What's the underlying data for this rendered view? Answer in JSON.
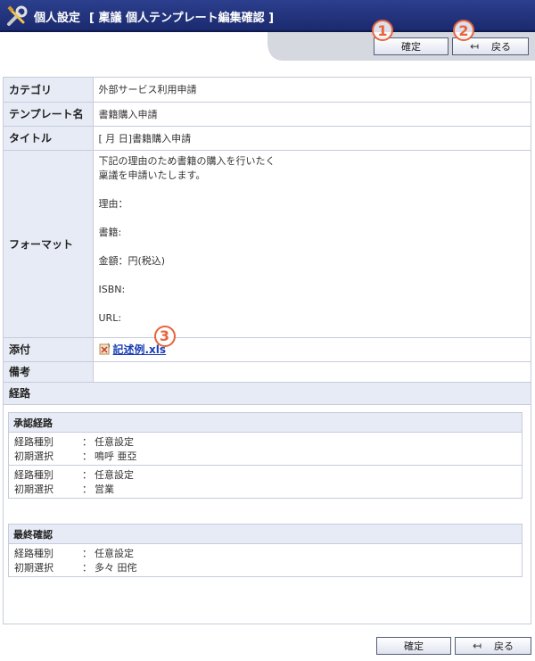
{
  "header": {
    "title": "個人設定",
    "subtitle": "[ 稟議 個人テンプレート編集確認 ]"
  },
  "toolbar": {
    "confirm_label": "確定",
    "back_label": "戻る",
    "back_icon": "back-arrow-icon",
    "badge_1": "1",
    "badge_2": "2"
  },
  "detail": {
    "category_label": "カテゴリ",
    "category_value": "外部サービス利用申請",
    "template_label": "テンプレート名",
    "template_value": "書籍購入申請",
    "title_label": "タイトル",
    "title_value": "[ 月 日]書籍購入申請",
    "format_label": "フォーマット",
    "format_lines": [
      "下記の理由のため書籍の購入を行いたく",
      "稟議を申請いたします。",
      "",
      "理由：",
      "",
      "書籍:",
      "",
      "金額：円(税込)",
      "",
      "ISBN:",
      "",
      "URL:"
    ],
    "attach_label": "添付",
    "attach_file": "記述例.xls",
    "badge_3": "3",
    "remarks_label": "備考",
    "remarks_value": "",
    "route_label": "経路"
  },
  "approval": {
    "heading": "承認経路",
    "groups": [
      {
        "type_key": "経路種別",
        "type_value": "任意設定",
        "init_key": "初期選択",
        "init_value": "鳴呼 亜亞"
      },
      {
        "type_key": "経路種別",
        "type_value": "任意設定",
        "init_key": "初期選択",
        "init_value": "営業"
      }
    ]
  },
  "final": {
    "heading": "最終確認",
    "groups": [
      {
        "type_key": "経路種別",
        "type_value": "任意設定",
        "init_key": "初期選択",
        "init_value": "多々 田侘"
      }
    ]
  },
  "colon": "：",
  "colors": {
    "header": "#1b2a6e",
    "label_bg": "#e7ebf5",
    "border": "#c6ccdd",
    "badge": "#e8633a",
    "link": "#1a3fb5"
  }
}
